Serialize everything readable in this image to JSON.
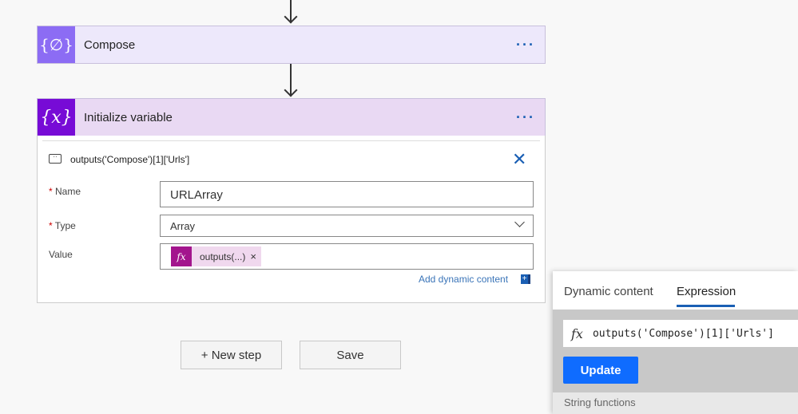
{
  "compose": {
    "title": "Compose",
    "icon": "compose-icon"
  },
  "init_var": {
    "title": "Initialize variable",
    "icon": "variable-icon",
    "comment": "outputs('Compose')[1]['Urls']",
    "name_label": "Name",
    "name_value": "URLArray",
    "type_label": "Type",
    "type_value": "Array",
    "value_label": "Value",
    "token_label": "outputs(...)",
    "token_remove": "×",
    "add_dynamic": "Add dynamic content"
  },
  "required_mark": "*",
  "actions": {
    "new_step": "+ New step",
    "save": "Save"
  },
  "panel": {
    "tabs": [
      {
        "label": "Dynamic content"
      },
      {
        "label": "Expression",
        "active": true
      }
    ],
    "fx": "fx",
    "expression": "outputs('Compose')[1]['Urls']",
    "update": "Update",
    "section": "String functions"
  },
  "colors": {
    "compose": "#8c6cf4",
    "variable": "#770bd6",
    "accent": "#0f6cff",
    "token": "#a3158d"
  }
}
